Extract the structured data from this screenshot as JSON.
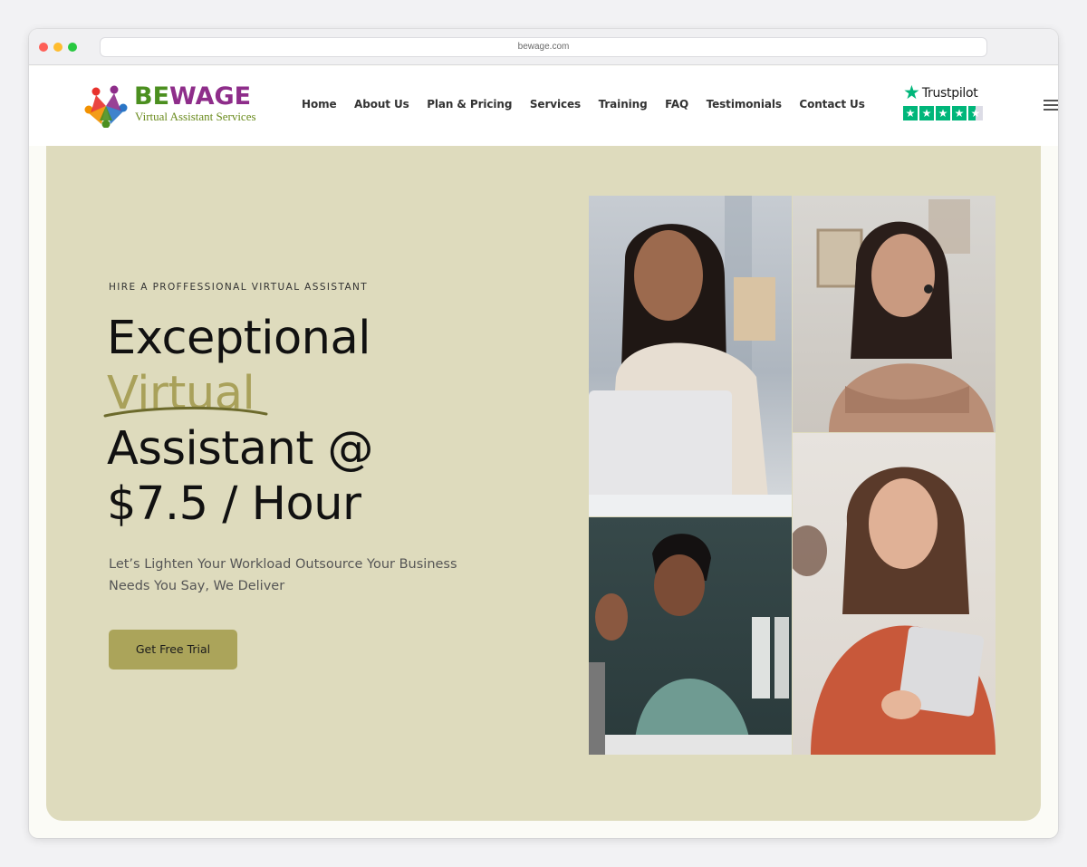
{
  "browser": {
    "url": "bewage.com"
  },
  "logo": {
    "word_be": "BE",
    "word_wage": "WAGE",
    "tagline": "Virtual Assistant Services"
  },
  "nav": {
    "items": [
      {
        "label": "Home"
      },
      {
        "label": "About Us"
      },
      {
        "label": "Plan & Pricing"
      },
      {
        "label": "Services"
      },
      {
        "label": "Training"
      },
      {
        "label": "FAQ"
      },
      {
        "label": "Testimonials"
      },
      {
        "label": "Contact Us"
      }
    ]
  },
  "trustpilot": {
    "label": "Trustpilot",
    "rating_stars": 4.5
  },
  "hero": {
    "eyebrow": "HIRE A PROFFESSIONAL VIRTUAL ASSISTANT",
    "headline_line1": "Exceptional",
    "headline_accent": "Virtual",
    "headline_line3": "Assistant @",
    "headline_line4": "$7.5 / Hour",
    "subtext": "Let’s Lighten Your Workload Outsource Your Business Needs You Say, We Deliver",
    "cta_label": "Get Free Trial"
  },
  "colors": {
    "hero_bg": "#dedbbd",
    "accent": "#a9a15a",
    "button": "#aba45a",
    "trustpilot_green": "#00b67a",
    "logo_green": "#4b8f1f",
    "logo_purple": "#8e2d8a"
  },
  "icons": {
    "logo_mark": "people-star-logo-icon",
    "trustpilot": "star-icon",
    "menu": "hamburger-menu-icon"
  }
}
